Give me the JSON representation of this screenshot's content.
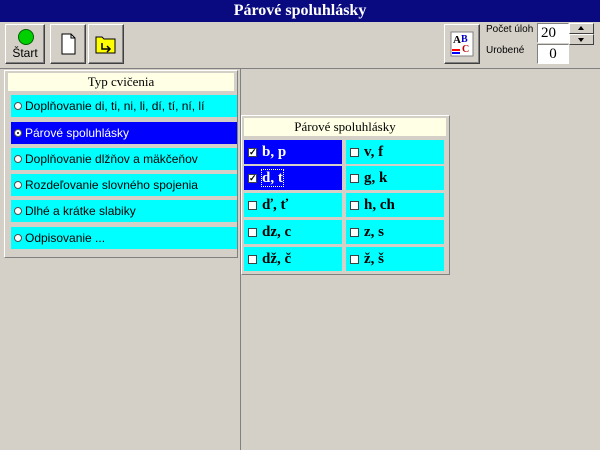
{
  "window": {
    "title": "Párové spoluhlásky"
  },
  "toolbar": {
    "start_label": "Štart",
    "pocet_uloh_label": "Počet úloh",
    "pocet_uloh_value": "20",
    "urobene_label": "Urobené",
    "urobene_value": "0"
  },
  "typ_cvicenia": {
    "title": "Typ cvičenia",
    "options": [
      {
        "label": "Doplňovanie di, ti, ni, li, dí, tí, ní, lí",
        "selected": false
      },
      {
        "label": "Párové spoluhlásky",
        "selected": true
      },
      {
        "label": "Doplňovanie dlžňov a mäkčeňov",
        "selected": false
      },
      {
        "label": "Rozdeľovanie slovného spojenia",
        "selected": false
      },
      {
        "label": "Dlhé a krátke slabiky",
        "selected": false
      },
      {
        "label": "Odpisovanie ...",
        "selected": false
      }
    ]
  },
  "parove": {
    "title": "Párové spoluhlásky",
    "left": [
      {
        "label": "b, p",
        "checked": true
      },
      {
        "label": "d, t",
        "checked": true
      },
      {
        "label": "ď, ť",
        "checked": false
      },
      {
        "label": "dz, c",
        "checked": false
      },
      {
        "label": "dž, č",
        "checked": false
      }
    ],
    "right": [
      {
        "label": "v, f",
        "checked": false
      },
      {
        "label": "g, k",
        "checked": false
      },
      {
        "label": "h, ch",
        "checked": false
      },
      {
        "label": "z, s",
        "checked": false
      },
      {
        "label": "ž, š",
        "checked": false
      }
    ]
  },
  "icons": {
    "start": "green-circle-icon",
    "new": "new-document-icon",
    "open": "open-folder-icon",
    "abc": "abc-font-icon"
  }
}
